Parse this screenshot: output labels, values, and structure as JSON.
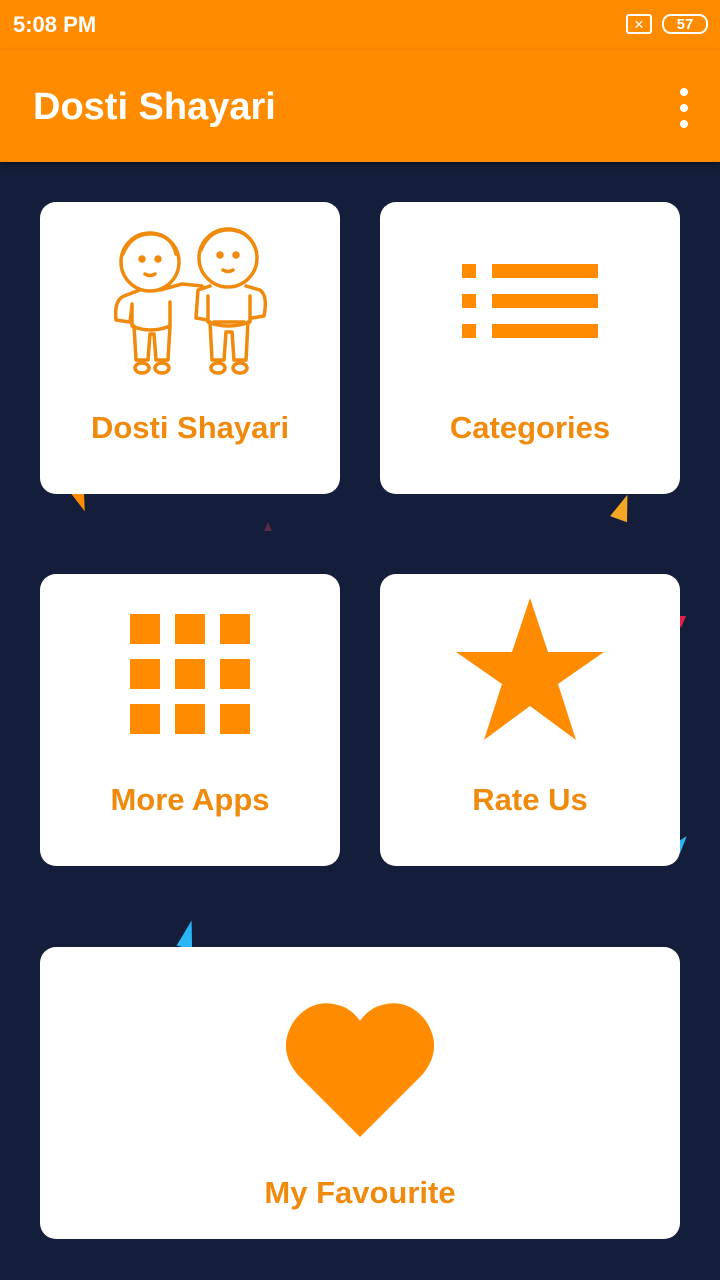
{
  "status_bar": {
    "time": "5:08 PM",
    "battery": "57",
    "sim_icon": "no-sim-icon",
    "sim_glyph": "✕"
  },
  "app_bar": {
    "title": "Dosti Shayari",
    "menu_icon": "overflow-menu-icon"
  },
  "colors": {
    "accent": "#ff8c00",
    "label": "#f08a0c",
    "background": "#141e3a",
    "card": "#ffffff"
  },
  "menu": {
    "dosti_shayari": {
      "label": "Dosti Shayari",
      "icon": "friends-icon"
    },
    "categories": {
      "label": "Categories",
      "icon": "list-icon"
    },
    "more_apps": {
      "label": "More Apps",
      "icon": "grid-icon"
    },
    "rate_us": {
      "label": "Rate Us",
      "icon": "star-icon"
    },
    "my_favourite": {
      "label": "My Favourite",
      "icon": "heart-icon"
    }
  }
}
